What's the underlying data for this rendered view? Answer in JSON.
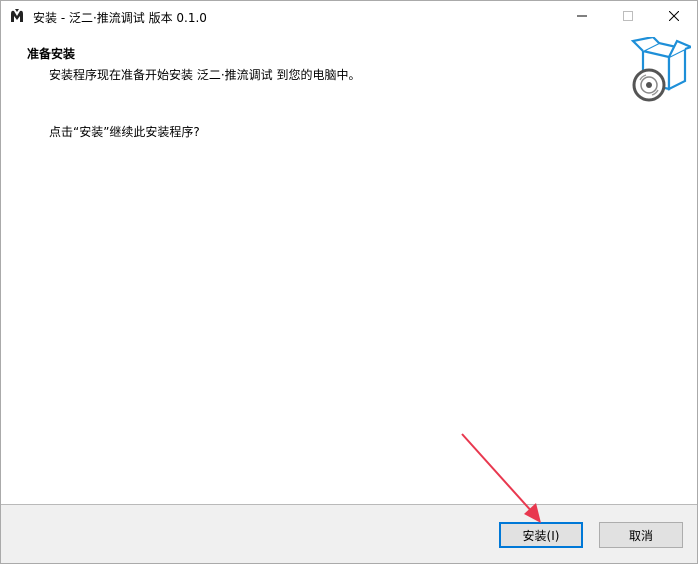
{
  "window": {
    "title": "安装 - 泛二·推流调试 版本 0.1.0",
    "controls": {
      "minimize": "─",
      "maximize": "☐",
      "close": "✕"
    }
  },
  "header": {
    "heading": "准备安装",
    "subheading": "安装程序现在准备开始安装 泛二·推流调试 到您的电脑中。"
  },
  "main": {
    "prompt": "点击“安装”继续此安装程序?"
  },
  "footer": {
    "install_label": "安装(I)",
    "cancel_label": "取消"
  },
  "colors": {
    "accent": "#0078d7",
    "annotation_arrow": "#e8384f",
    "footer_bg": "#f0f0f0"
  },
  "icons": {
    "app": "app-icon",
    "header": "install-box-disc-icon"
  }
}
